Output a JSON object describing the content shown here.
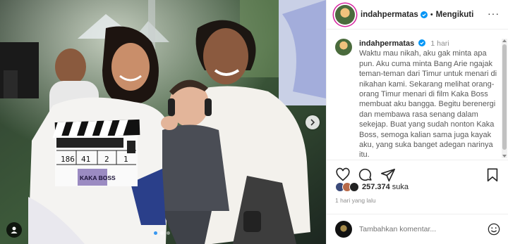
{
  "post": {
    "username": "indahpermatas",
    "follow_status": "Mengikuti",
    "more_icon": "more-options-icon",
    "caption": {
      "username": "indahpermatas",
      "time": "1 hari",
      "text": "Waktu mau nikah, aku gak minta apa pun. Aku cuma minta Bang Arie ngajak teman-teman dari Timur untuk menari di nikahan kami. Sekarang melihat orang-orang Timur menari di film Kaka Boss membuat aku bangga. Begitu berenergi dan membawa rasa senang dalam sekejap. Buat yang sudah nonton Kaka Boss, semoga kalian sama juga kayak aku, yang suka banget adegan narinya itu."
    },
    "likes_count": "257.374",
    "likes_suffix": "suka",
    "posted_ago": "1 hari yang lalu",
    "comment_placeholder": "Tambahkan komentar..."
  },
  "photo": {
    "clapperboard": {
      "roll": "186",
      "scene": "41",
      "take1": "2",
      "take2": "1",
      "title": "KAKA BOSS"
    },
    "carousel_dots": 3,
    "active_dot": 1
  },
  "colors": {
    "verified": "#0095f6",
    "active_dot": "#3897f0",
    "story_ring": "#d6249f",
    "text": "#262626",
    "muted": "#8e8e8e"
  }
}
